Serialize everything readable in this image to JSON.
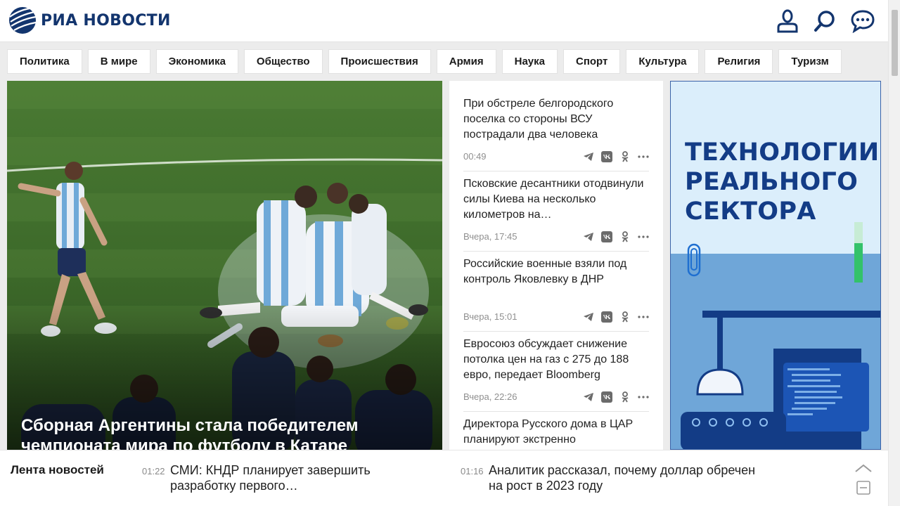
{
  "header": {
    "logo_text": "РИА НОВОСТИ",
    "icons": [
      "user-icon",
      "search-icon",
      "chat-icon"
    ],
    "brand_color": "#13356e"
  },
  "nav": {
    "items": [
      "Политика",
      "В мире",
      "Экономика",
      "Общество",
      "Происшествия",
      "Армия",
      "Наука",
      "Спорт",
      "Культура",
      "Религия",
      "Туризм"
    ]
  },
  "hero": {
    "title": "Сборная Аргентины стала победителем чемпионата мира по футболу в Катаре"
  },
  "news": {
    "items": [
      {
        "title": "При обстреле белгородского поселка со стороны ВСУ пострадали два человека",
        "time": "00:49"
      },
      {
        "title": "Псковские десантники отодвинули силы Киева на несколько километров на…",
        "time": "Вчера, 17:45"
      },
      {
        "title": "Российские военные взяли под контроль Яковлевку в ДНР",
        "time": "Вчера, 15:01"
      },
      {
        "title": "Евросоюз обсуждает снижение потолка цен на газ с 275 до 188 евро, передает Bloomberg",
        "time": "Вчера, 22:26"
      },
      {
        "title": "Директора Русского дома в ЦАР планируют экстренно",
        "time": ""
      }
    ],
    "share_icons": [
      "telegram-icon",
      "vk-icon",
      "odnoklassniki-icon",
      "more-icon"
    ]
  },
  "ad": {
    "line1": "ТЕХНОЛОГИИ",
    "line2": "РЕАЛЬНОГО",
    "line3": "СЕКТОРА"
  },
  "lenta": {
    "label": "Лента новостей",
    "items": [
      {
        "time": "01:22",
        "text": "СМИ: КНДР планирует завершить разработку первого…"
      },
      {
        "time": "01:16",
        "text": "Аналитик рассказал, почему доллар обречен на рост в 2023 году"
      }
    ]
  }
}
